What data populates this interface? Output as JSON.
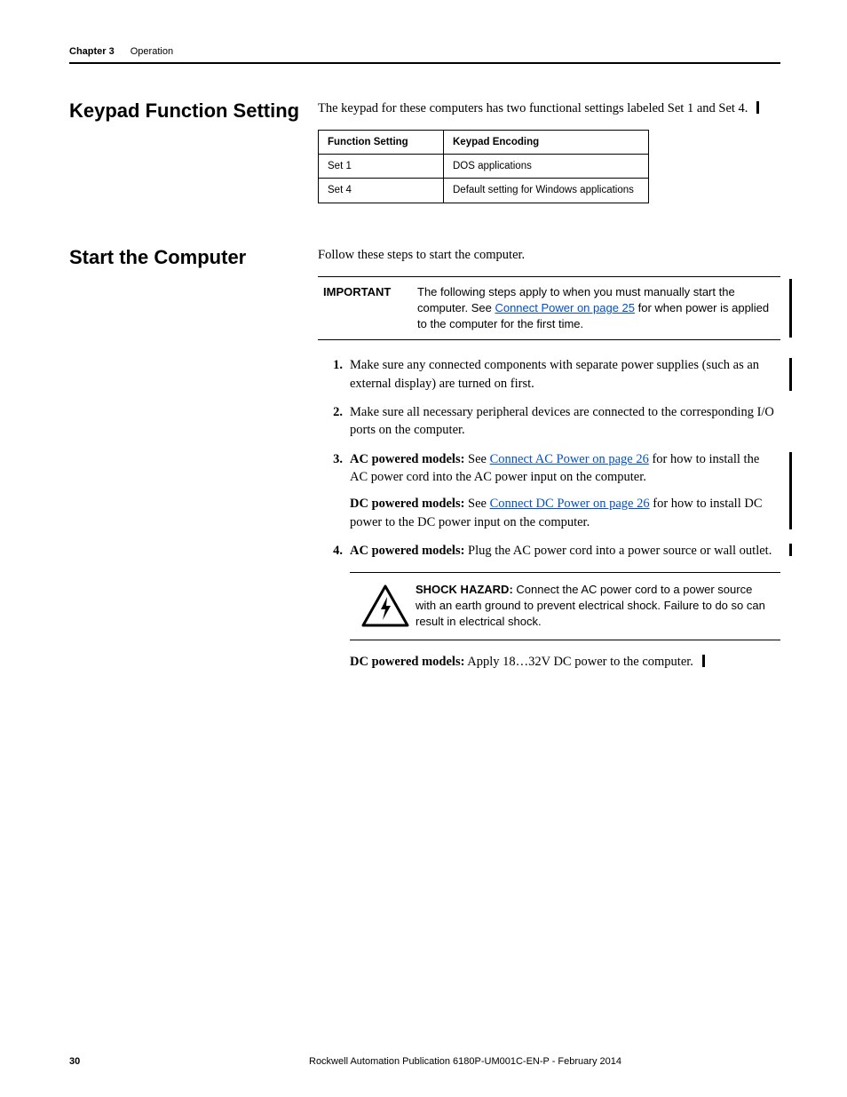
{
  "header": {
    "chapter_label": "Chapter 3",
    "chapter_title": "Operation"
  },
  "section1": {
    "heading": "Keypad Function Setting",
    "intro": "The keypad for these computers has two functional settings labeled Set 1 and Set 4.",
    "table": {
      "headers": [
        "Function Setting",
        "Keypad Encoding"
      ],
      "rows": [
        [
          "Set 1",
          "DOS applications"
        ],
        [
          "Set 4",
          "Default setting for Windows applications"
        ]
      ]
    }
  },
  "section2": {
    "heading": "Start the Computer",
    "intro": "Follow these steps to start the computer.",
    "important": {
      "label": "IMPORTANT",
      "pre": "The following steps apply to when you must manually start the computer. See ",
      "link": "Connect Power on page 25",
      "post": " for when power is applied to the computer for the first time."
    },
    "steps": {
      "s1": "Make sure any connected components with separate power supplies (such as an external display) are turned on first.",
      "s2": "Make sure all necessary peripheral devices are connected to the corresponding I/O ports on the computer.",
      "s3": {
        "ac_label": "AC powered models:",
        "ac_pre": " See ",
        "ac_link": "Connect AC Power on page 26",
        "ac_post": " for how to install the AC power cord into the AC power input on the computer.",
        "dc_label": "DC powered models:",
        "dc_pre": " See ",
        "dc_link": "Connect DC Power on page 26",
        "dc_post": " for how to install DC power to the DC power input on the computer."
      },
      "s4": {
        "ac_label": "AC powered models:",
        "ac_text": " Plug the AC power cord into a power source or wall outlet.",
        "hazard_label": "SHOCK HAZARD:",
        "hazard_text": " Connect the AC power cord to a power source with an earth ground to prevent electrical shock. Failure to do so can result in electrical shock.",
        "dc_label": "DC powered models:",
        "dc_text": " Apply 18…32V DC power to the computer."
      }
    }
  },
  "footer": {
    "page": "30",
    "pub": "Rockwell Automation Publication 6180P-UM001C-EN-P - February 2014"
  }
}
